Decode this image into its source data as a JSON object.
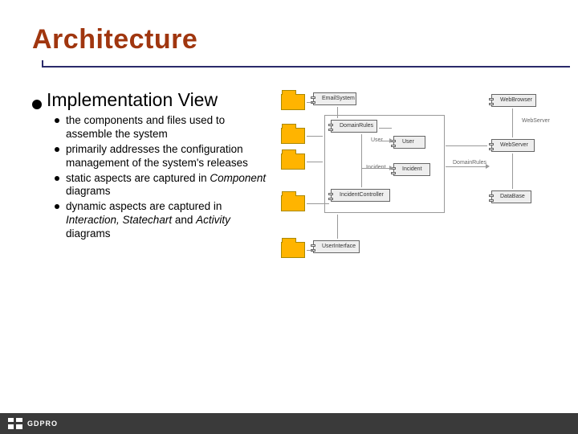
{
  "title": "Architecture",
  "main_bullet": "Implementation View",
  "sub_bullets": [
    {
      "plain": "the components and files used to assemble the system"
    },
    {
      "plain": "primarily addresses the configuration management of the system's releases"
    },
    {
      "pre": "static aspects are captured in ",
      "em": "Component",
      "post": " diagrams"
    },
    {
      "pre": "dynamic aspects are captured in ",
      "em": "Interaction, Statechart",
      "mid": " and ",
      "em2": "Activity",
      "post": " diagrams"
    }
  ],
  "diagram": {
    "components": {
      "email": "EmailSystem",
      "browser": "WebBrowser",
      "webserver": "WebServer",
      "database": "DataBase",
      "domain": "DomainRules",
      "user": "User",
      "incident": "Incident",
      "controller": "IncidentController",
      "ui": "UserInterface"
    },
    "labels": {
      "domainrules": "DomainRules",
      "webserver": "WebServer",
      "user": "User",
      "incident": "Incident"
    }
  },
  "footer": {
    "brand": "GDPRO"
  }
}
